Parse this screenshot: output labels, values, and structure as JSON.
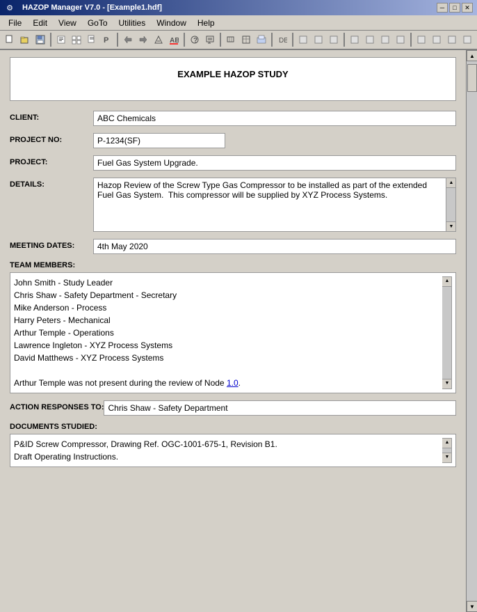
{
  "titlebar": {
    "title": "HAZOP Manager V7.0 - [Example1.hdf]",
    "icon": "H",
    "controls": {
      "minimize": "─",
      "restore": "□",
      "close": "✕"
    }
  },
  "menubar": {
    "items": [
      {
        "id": "file",
        "label": "File"
      },
      {
        "id": "edit",
        "label": "Edit"
      },
      {
        "id": "view",
        "label": "View"
      },
      {
        "id": "goto",
        "label": "GoTo"
      },
      {
        "id": "utilities",
        "label": "Utilities"
      },
      {
        "id": "window",
        "label": "Window"
      },
      {
        "id": "help",
        "label": "Help"
      }
    ]
  },
  "study": {
    "title": "EXAMPLE HAZOP STUDY",
    "client_label": "CLIENT:",
    "client_value": "ABC Chemicals",
    "project_no_label": "PROJECT NO:",
    "project_no_value": "P-1234(SF)",
    "project_label": "PROJECT:",
    "project_value": "Fuel Gas System Upgrade.",
    "details_label": "DETAILS:",
    "details_value": "Hazop Review of the Screw Type Gas Compressor to be installed as part of the extended Fuel Gas System.  This compressor will be supplied by XYZ Process Systems.",
    "meeting_dates_label": "MEETING DATES:",
    "meeting_dates_value": "4th May 2020",
    "team_members_label": "TEAM MEMBERS:",
    "team_members_lines": [
      "John Smith - Study Leader",
      "Chris Shaw - Safety Department - Secretary",
      "Mike Anderson - Process",
      "Harry Peters - Mechanical",
      "Arthur Temple - Operations",
      "Lawrence Ingleton - XYZ Process Systems",
      "David Matthews - XYZ Process Systems"
    ],
    "team_note_prefix": "Arthur Temple was not present during the review of Node ",
    "team_note_link": "1.0",
    "team_note_suffix": ".",
    "action_responses_label": "ACTION RESPONSES TO:",
    "action_responses_value": "Chris Shaw - Safety Department",
    "documents_studied_label": "DOCUMENTS STUDIED:",
    "documents_lines": [
      "P&ID Screw Compressor, Drawing Ref. OGC-1001-675-1, Revision B1.",
      "Draft Operating Instructions."
    ]
  }
}
